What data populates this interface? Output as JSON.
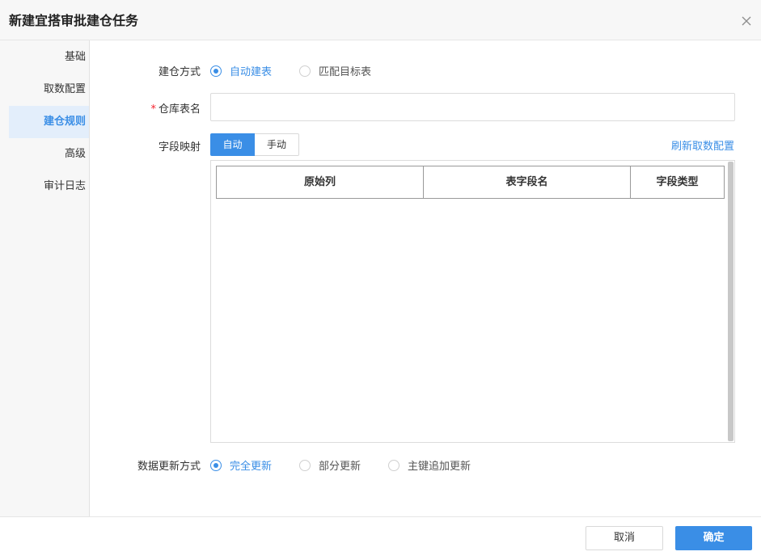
{
  "dialog": {
    "title": "新建宜搭审批建仓任务",
    "close_icon": "close-icon"
  },
  "sidebar": {
    "items": [
      {
        "label": "基础"
      },
      {
        "label": "取数配置"
      },
      {
        "label": "建仓规则"
      },
      {
        "label": "高级"
      },
      {
        "label": "审计日志"
      }
    ],
    "active_index": 2
  },
  "form": {
    "build_mode": {
      "label": "建仓方式",
      "options": [
        "自动建表",
        "匹配目标表"
      ],
      "selected": "自动建表"
    },
    "table_name": {
      "required_mark": "*",
      "label": "仓库表名",
      "value": "",
      "placeholder": ""
    },
    "field_mapping": {
      "label": "字段映射",
      "modes": [
        "自动",
        "手动"
      ],
      "selected": "自动",
      "refresh_link": "刷新取数配置",
      "columns": [
        "原始列",
        "表字段名",
        "字段类型"
      ],
      "rows": []
    },
    "update_mode": {
      "label": "数据更新方式",
      "options": [
        "完全更新",
        "部分更新",
        "主键追加更新"
      ],
      "selected": "完全更新"
    }
  },
  "footer": {
    "cancel_label": "取消",
    "ok_label": "确定"
  },
  "colors": {
    "accent": "#3a8ee6",
    "sidebar_active_bg": "#e3eefb",
    "required": "#f5222d"
  }
}
